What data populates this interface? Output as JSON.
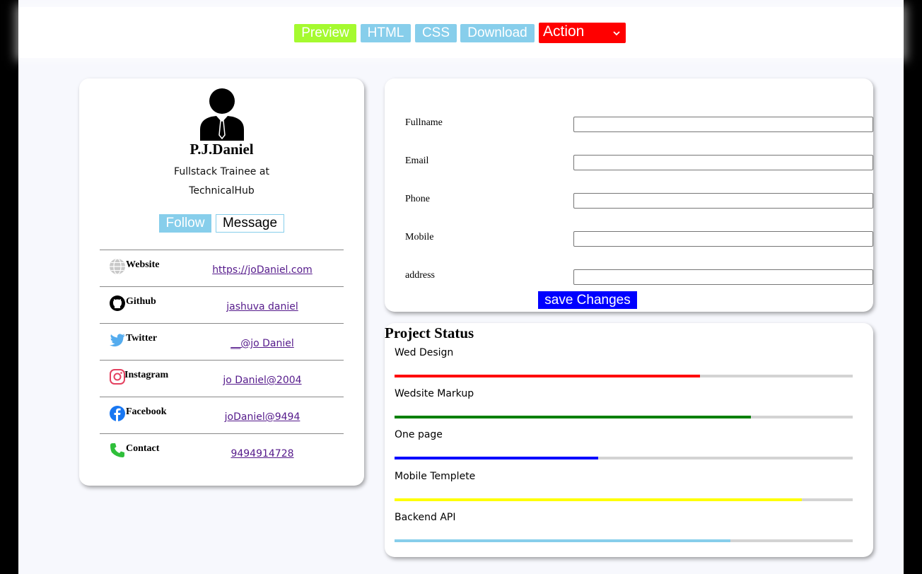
{
  "toolbar": {
    "preview": "Preview",
    "html": "HTML",
    "css": "CSS",
    "download": "Download",
    "action": "Action"
  },
  "profile": {
    "name": "P.J.Daniel",
    "role": "Fullstack Trainee at TechnicalHub",
    "follow": "Follow",
    "message": "Message",
    "social": [
      {
        "icon": "globe-icon",
        "label": "Website",
        "value": "https://joDaniel.com"
      },
      {
        "icon": "github-icon",
        "label": "Github",
        "value": "jashuva daniel"
      },
      {
        "icon": "twitter-icon",
        "label": "Twitter",
        "value": "__@jo Daniel"
      },
      {
        "icon": "instagram-icon",
        "label": "Instagram",
        "value": "jo Daniel@2004"
      },
      {
        "icon": "facebook-icon",
        "label": "Facebook",
        "value": "joDaniel@9494"
      },
      {
        "icon": "phone-icon",
        "label": "Contact",
        "value": "9494914728"
      }
    ]
  },
  "form": {
    "fields": [
      {
        "label": "Fullname",
        "value": ""
      },
      {
        "label": "Email",
        "value": ""
      },
      {
        "label": "Phone",
        "value": ""
      },
      {
        "label": "Mobile",
        "value": ""
      },
      {
        "label": "address",
        "value": ""
      }
    ],
    "save": "save Changes"
  },
  "projects": {
    "title": "Project Status",
    "items": [
      {
        "name": "Wed Design",
        "progress": 0.667,
        "color": "#ff0000"
      },
      {
        "name": "Wedsite Markup",
        "progress": 0.778,
        "color": "#008000"
      },
      {
        "name": "One page",
        "progress": 0.444,
        "color": "#0000ff"
      },
      {
        "name": "Mobile Templete",
        "progress": 0.889,
        "color": "#ffff00"
      },
      {
        "name": "Backend API",
        "progress": 0.733,
        "color": "#87ceeb"
      }
    ]
  }
}
